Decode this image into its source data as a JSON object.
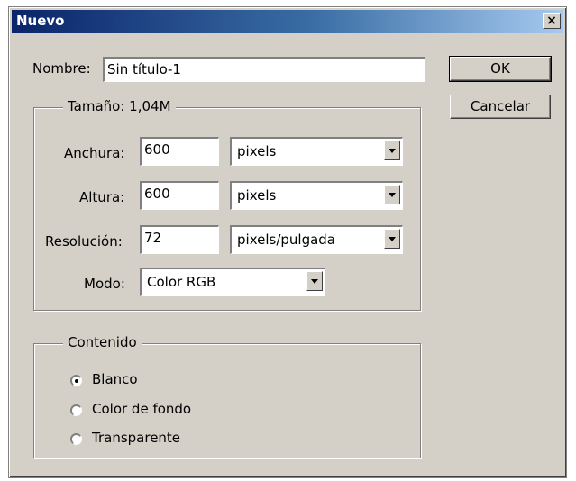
{
  "dialog": {
    "title": "Nuevo",
    "close_glyph": "×"
  },
  "name_field": {
    "label": "Nombre:",
    "value": "Sin título-1"
  },
  "buttons": {
    "ok": "OK",
    "cancel": "Cancelar"
  },
  "size_group": {
    "legend": "Tamaño: 1,04M",
    "width": {
      "label": "Anchura:",
      "value": "600",
      "unit": "pixels"
    },
    "height": {
      "label": "Altura:",
      "value": "600",
      "unit": "pixels"
    },
    "resolution": {
      "label": "Resolución:",
      "value": "72",
      "unit": "pixels/pulgada"
    },
    "mode": {
      "label": "Modo:",
      "value": "Color RGB"
    }
  },
  "content_group": {
    "legend": "Contenido",
    "options": [
      {
        "label": "Blanco",
        "selected": true
      },
      {
        "label": "Color de fondo",
        "selected": false
      },
      {
        "label": "Transparente",
        "selected": false
      }
    ]
  },
  "colors": {
    "titlebar_start": "#0a246a",
    "titlebar_end": "#a6caf0",
    "face": "#d4d0c8"
  }
}
